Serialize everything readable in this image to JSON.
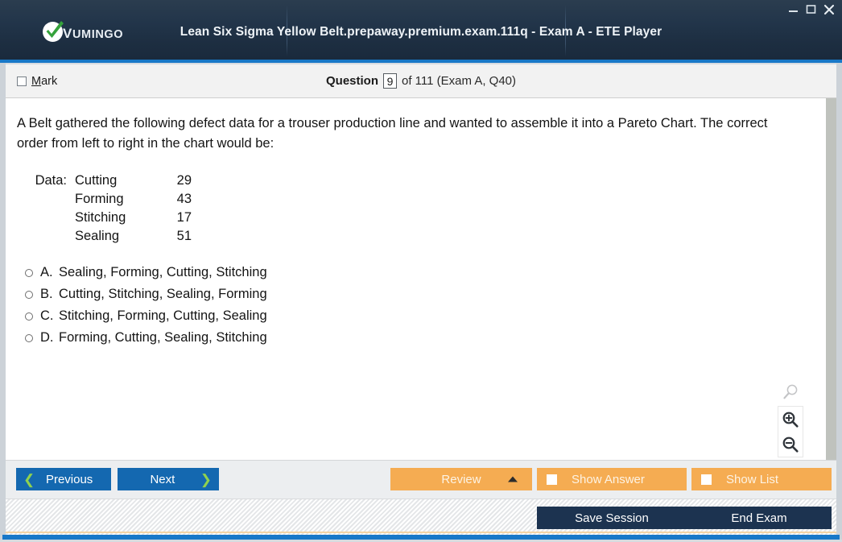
{
  "window": {
    "title": "Lean Six Sigma Yellow Belt.prepaway.premium.exam.111q - Exam A - ETE Player",
    "logo_text_cap": "V",
    "logo_text_rest": "UMINGO",
    "controls": {
      "minimize": "minimize-icon",
      "maximize": "maximize-icon",
      "close": "close-icon"
    },
    "accent_blue": "#1878c8",
    "titlebar_color": "#22354a"
  },
  "question_bar": {
    "mark_label_accel": "M",
    "mark_label_rest": "ark",
    "mark_checked": false,
    "question_word": "Question",
    "question_number": "9",
    "rest": "of 111 (Exam A, Q40)"
  },
  "content": {
    "question_text": "A Belt gathered the following defect data for a trouser production line and wanted to assemble it into a Pareto Chart. The correct order from left to right in the chart would be:",
    "data_label": "Data:",
    "data_rows": [
      {
        "name": "Cutting",
        "value": "29"
      },
      {
        "name": "Forming",
        "value": "43"
      },
      {
        "name": "Stitching",
        "value": "17"
      },
      {
        "name": "Sealing",
        "value": "51"
      }
    ],
    "options": [
      {
        "letter": "A.",
        "text": "Sealing, Forming, Cutting, Stitching",
        "selected": false
      },
      {
        "letter": "B.",
        "text": "Cutting, Stitching, Sealing, Forming",
        "selected": false
      },
      {
        "letter": "C.",
        "text": "Stitching, Forming, Cutting, Sealing",
        "selected": false
      },
      {
        "letter": "D.",
        "text": "Forming, Cutting, Sealing, Stitching",
        "selected": false
      }
    ],
    "zoom_tools": {
      "reset": "magnifier-icon",
      "zoom_in": "zoom-in-icon",
      "zoom_out": "zoom-out-icon"
    }
  },
  "action_bar": {
    "previous": "Previous",
    "next": "Next",
    "review": "Review",
    "show_answer": "Show Answer",
    "show_list": "Show List",
    "show_answer_checked": false,
    "show_list_checked": false,
    "orange": "#f5ac52",
    "nav_blue": "#1468b0",
    "chevron_green": "#8fd14f"
  },
  "status_bar": {
    "save_session": "Save Session",
    "end_exam": "End Exam",
    "dark_navy": "#1c3350"
  }
}
